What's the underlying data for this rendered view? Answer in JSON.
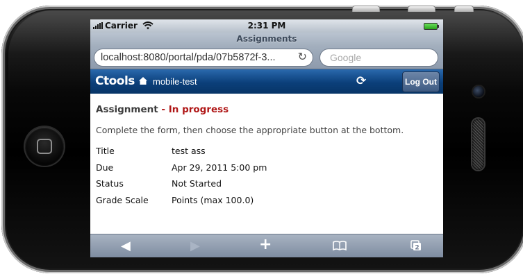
{
  "status_bar": {
    "carrier": "Carrier",
    "time": "2:31 PM"
  },
  "browser": {
    "page_title": "Assignments",
    "url": "localhost:8080/portal/pda/07b5872f-3...",
    "search_placeholder": "Google"
  },
  "app": {
    "logo": "Ctools",
    "site_name": "mobile-test",
    "logout_label": "Log Out"
  },
  "assignment": {
    "heading_prefix": "Assignment",
    "heading_separator": " - ",
    "status_text": "In progress",
    "status_color": "#b01717",
    "instructions": "Complete the form, then choose the appropriate button at the bottom.",
    "properties": [
      {
        "label": "Title",
        "value": "test ass"
      },
      {
        "label": "Due",
        "value": "Apr 29, 2011 5:00 pm"
      },
      {
        "label": "Status",
        "value": "Not Started"
      },
      {
        "label": "Grade Scale",
        "value": "Points (max 100.0)"
      }
    ]
  },
  "toolbar": {
    "back_icon": "back-arrow-icon",
    "forward_icon": "forward-arrow-icon",
    "add_icon": "plus-icon",
    "bookmarks_icon": "book-icon",
    "pages_icon": "pages-icon",
    "pages_count": "2"
  },
  "colors": {
    "header_blue": "#0b3f7a",
    "status_red": "#b01717"
  }
}
